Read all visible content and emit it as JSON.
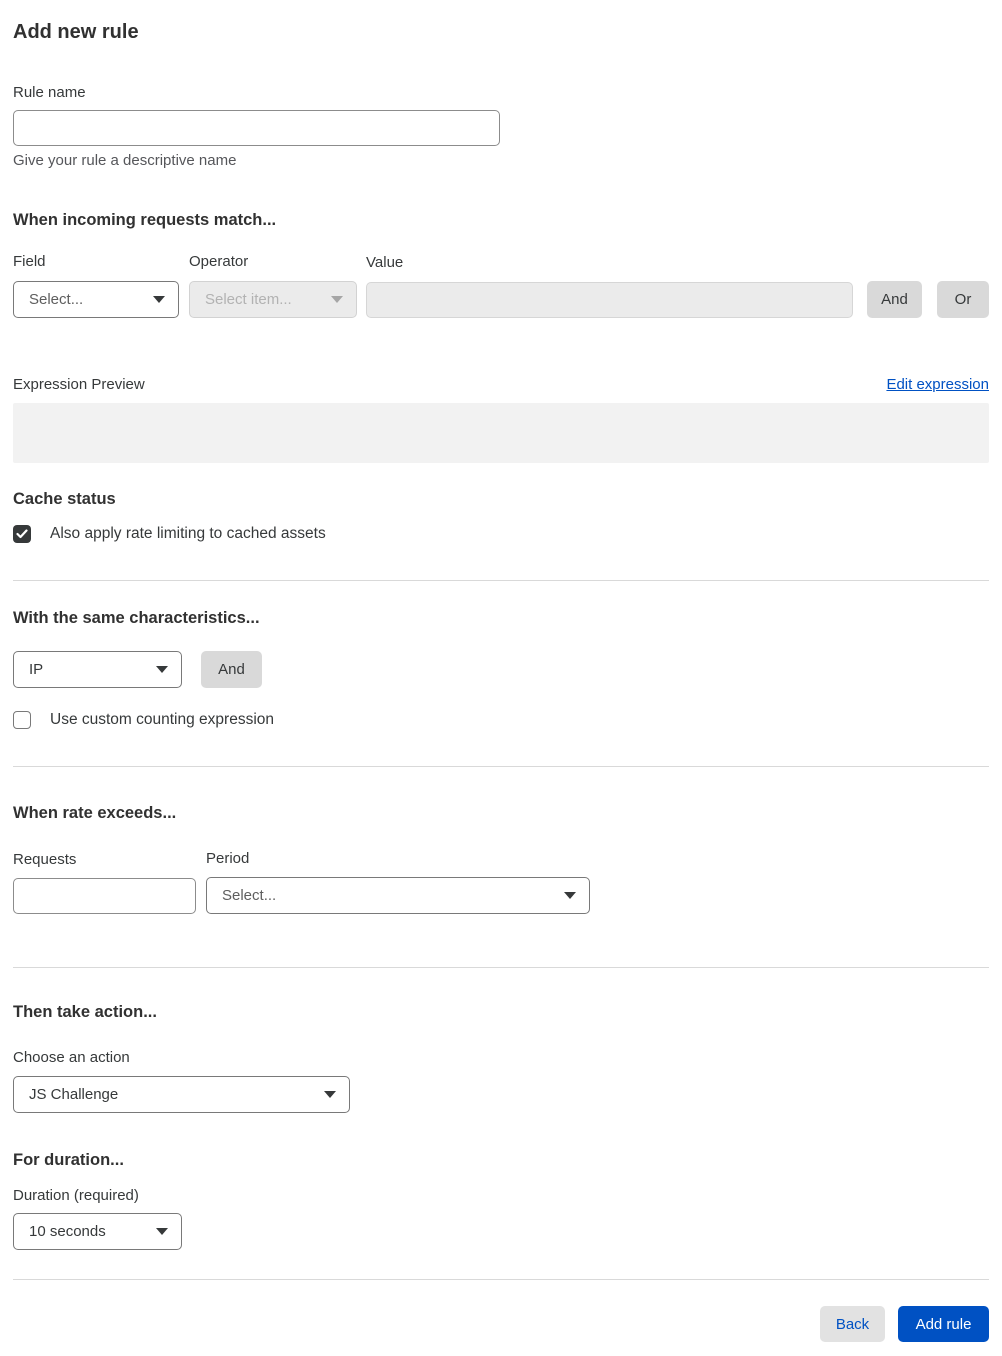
{
  "page": {
    "title": "Add new rule"
  },
  "rule_name": {
    "label": "Rule name",
    "value": "",
    "helper": "Give your rule a descriptive name"
  },
  "match_section": {
    "heading": "When incoming requests match...",
    "field": {
      "label": "Field",
      "selected": "Select..."
    },
    "operator": {
      "label": "Operator",
      "selected": "Select item...",
      "disabled": true
    },
    "value": {
      "label": "Value",
      "value": "",
      "disabled": true
    },
    "and_button": "And",
    "or_button": "Or",
    "expression_preview": {
      "label": "Expression Preview",
      "edit_link": "Edit expression",
      "content": ""
    }
  },
  "cache_section": {
    "heading": "Cache status",
    "checkbox_label": "Also apply rate limiting to cached assets",
    "checked": true
  },
  "characteristics_section": {
    "heading": "With the same characteristics...",
    "selected": "IP",
    "and_button": "And",
    "checkbox_label": "Use custom counting expression",
    "checked": false
  },
  "rate_section": {
    "heading": "When rate exceeds...",
    "requests": {
      "label": "Requests",
      "value": ""
    },
    "period": {
      "label": "Period",
      "selected": "Select..."
    }
  },
  "action_section": {
    "heading": "Then take action...",
    "action_label": "Choose an action",
    "selected": "JS Challenge"
  },
  "duration_section": {
    "heading": "For duration...",
    "duration_label": "Duration (required)",
    "selected": "10 seconds"
  },
  "footer": {
    "back_button": "Back",
    "add_rule_button": "Add rule"
  },
  "colors": {
    "primary_blue": "#0051c3",
    "link_blue": "#0051c3",
    "checkbox_checked_bg": "#36393a",
    "disabled_bg": "#ebebeb",
    "divider": "#d9d9d9",
    "preview_bg": "#f2f2f2",
    "gray_button_bg": "#d9d9d9"
  }
}
